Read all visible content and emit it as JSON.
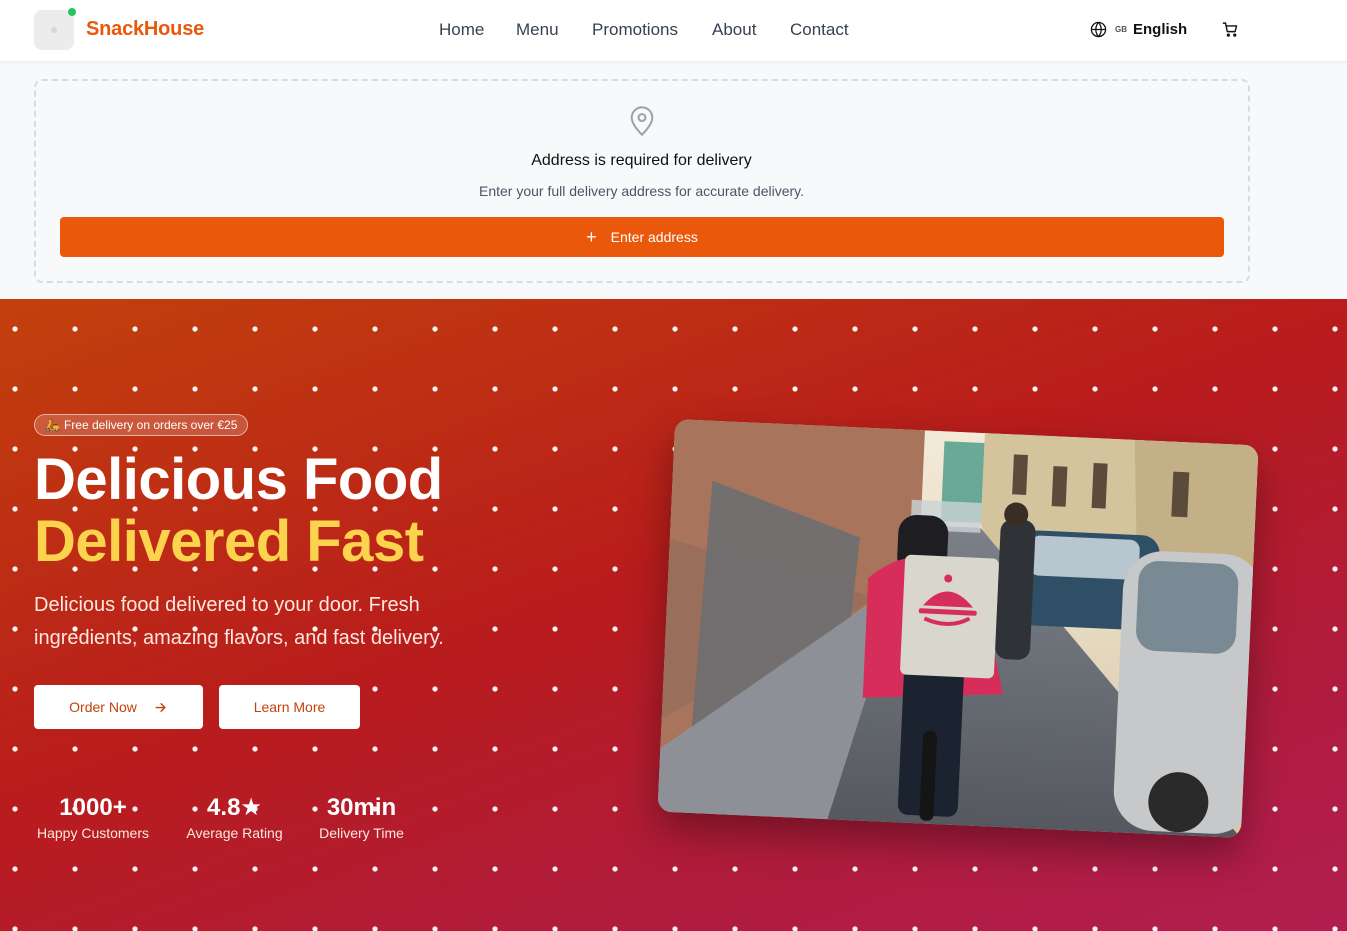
{
  "header": {
    "brand": "SnackHouse",
    "nav": [
      {
        "label": "Home"
      },
      {
        "label": "Menu"
      },
      {
        "label": "Promotions"
      },
      {
        "label": "About"
      },
      {
        "label": "Contact"
      }
    ],
    "language_code": "GB",
    "language_label": "English"
  },
  "address": {
    "title": "Address is required for delivery",
    "subtitle": "Enter your full delivery address for accurate delivery.",
    "button_label": "Enter address"
  },
  "hero": {
    "badge": "Free delivery on orders over €25",
    "title_line1": "Delicious Food",
    "title_line2": "Delivered Fast",
    "description": "Delicious food delivered to your door. Fresh ingredients, amazing flavors, and fast delivery.",
    "order_button": "Order Now",
    "learn_button": "Learn More",
    "stats": [
      {
        "value": "1000+",
        "label": "Happy Customers"
      },
      {
        "value": "4.8★",
        "label": "Average Rating"
      },
      {
        "value": "30min",
        "label": "Delivery Time"
      }
    ]
  },
  "colors": {
    "brand": "#ea580c",
    "accent_yellow": "#fcd34d",
    "hero_start": "#c2410c",
    "hero_end": "#b21e50"
  },
  "icons": [
    "globe-icon",
    "cart-icon",
    "map-pin-icon",
    "plus-icon",
    "scooter-icon",
    "arrow-right-icon"
  ]
}
